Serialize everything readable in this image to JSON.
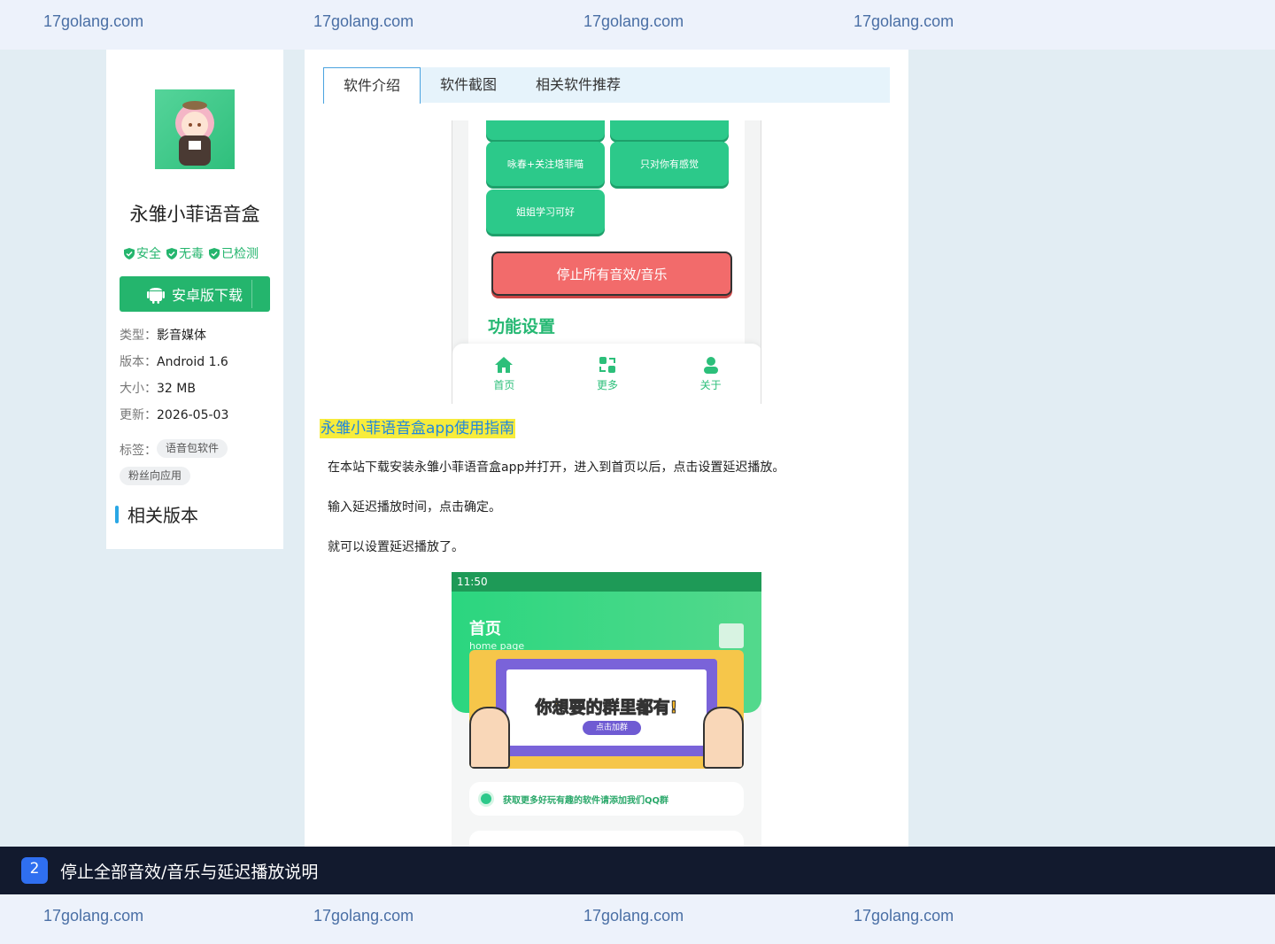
{
  "watermark": "17golang.com",
  "sidebar": {
    "app_name": "永雏小菲语音盒",
    "badges": [
      "安全",
      "无毒",
      "已检测"
    ],
    "download_label": "安卓版下载",
    "meta": [
      {
        "key": "类型：",
        "value": "影音媒体"
      },
      {
        "key": "版本：",
        "value": "Android 1.6"
      },
      {
        "key": "大小：",
        "value": "32 MB"
      },
      {
        "key": "更新：",
        "value": "2026-05-03"
      }
    ],
    "tags_label": "标签：",
    "tags": [
      "语音包软件",
      "粉丝向应用"
    ],
    "related_title": "相关版本"
  },
  "tabs": [
    {
      "label": "软件介绍",
      "active": true
    },
    {
      "label": "软件截图",
      "active": false
    },
    {
      "label": "相关软件推荐",
      "active": false
    }
  ],
  "screenshot1": {
    "buttons": [
      "咏春+关注塔菲喵",
      "只对你有感觉",
      "姐姐学习可好"
    ],
    "stop_button": "停止所有音效/音乐",
    "section_title": "功能设置",
    "nav": [
      "首页",
      "更多",
      "关于"
    ]
  },
  "guide": {
    "title": "永雏小菲语音盒app使用指南",
    "steps": [
      "在本站下载安装永雏小菲语音盒app并打开，进入到首页以后，点击设置延迟播放。",
      "输入延迟播放时间，点击确定。",
      "就可以设置延迟播放了。"
    ]
  },
  "screenshot2": {
    "time": "11:50",
    "title": "首页",
    "subtitle": "home page",
    "banner_slogan": "你想要的群里都有!",
    "banner_button": "点击加群",
    "qq_text": "获取更多好玩有趣的软件请添加我们QQ群"
  },
  "caption": {
    "number": "2",
    "text": "停止全部音效/音乐与延迟播放说明"
  },
  "colors": {
    "accent_green": "#24b56d",
    "tab_border": "#4aa3df",
    "guide_highlight": "#f7ec3c",
    "caption_bg": "#121a2e",
    "caption_badge": "#2f6ff0"
  }
}
